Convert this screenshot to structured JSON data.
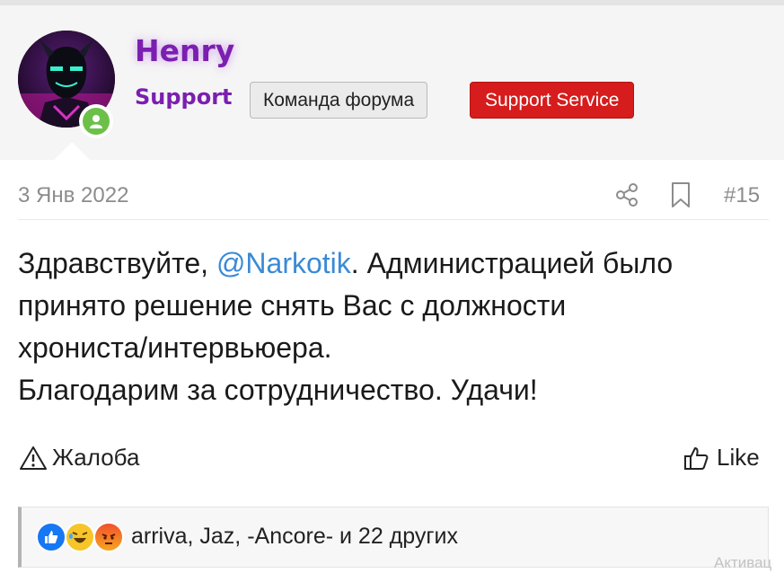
{
  "user": {
    "name": "Henry",
    "title": "Support",
    "badges": [
      "Команда форума",
      "Support Service"
    ],
    "online": true
  },
  "post": {
    "date": "3 Янв 2022",
    "number": "#15",
    "body": {
      "greeting": "Здравствуйте, ",
      "mention": "@Narkotik",
      "line1_rest": ". Администрацией было",
      "line2": "принято решение снять Вас с должности",
      "line3": "хрониста/интервьюера.",
      "line4": "Благодарим за сотрудничество. Удачи!"
    }
  },
  "actions": {
    "report_label": "Жалоба",
    "like_label": "Like"
  },
  "reactions": {
    "icons": [
      "like-icon",
      "haha-icon",
      "angry-icon"
    ],
    "text": "arriva, Jaz, -Ancore- и 22 других"
  },
  "watermark": "Активац",
  "colors": {
    "username": "#7b1fb0",
    "mention": "#3a8ad6",
    "support_badge": "#d61c1c",
    "online": "#6cc04a"
  }
}
